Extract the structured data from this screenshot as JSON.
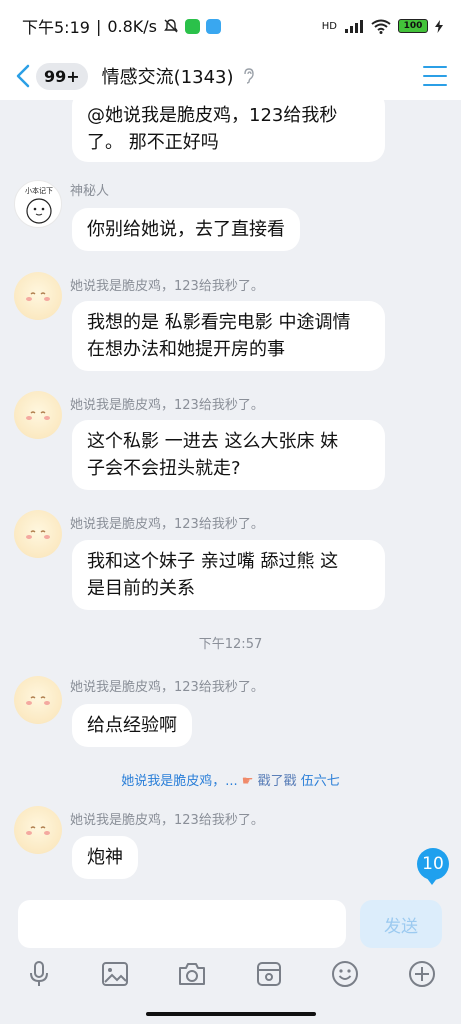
{
  "status": {
    "time": "下午5:19",
    "speed": "0.8K/s",
    "network": "HD",
    "battery": "100"
  },
  "header": {
    "unread_badge": "99+",
    "title": "情感交流(1343)",
    "accent": "#2b9fe6"
  },
  "messages": [
    {
      "sender": "",
      "text": "@她说我是脆皮鸡，123给我秒\n了。 那不正好吗"
    },
    {
      "sender": "神秘人",
      "avatar_text": "小本记下",
      "text": "你别给她说，去了直接看"
    },
    {
      "sender": "她说我是脆皮鸡，123给我秒了。",
      "text": "我想的是 私影看完电影 中途调情\n在想办法和她提开房的事"
    },
    {
      "sender": "她说我是脆皮鸡，123给我秒了。",
      "text": "这个私影 一进去 这么大张床 妹\n子会不会扭头就走?"
    },
    {
      "sender": "她说我是脆皮鸡，123给我秒了。",
      "text": "我和这个妹子 亲过嘴 舔过熊 这\n是目前的关系"
    },
    {
      "sender": "她说我是脆皮鸡，123给我秒了。",
      "text": "给点经验啊"
    },
    {
      "sender": "她说我是脆皮鸡，123给我秒了。",
      "text": "炮神"
    }
  ],
  "timestamp": "下午12:57",
  "notice": {
    "from": "她说我是脆皮鸡，...",
    "action": "戳了戳",
    "to": "伍六七"
  },
  "unread_count": "10",
  "input": {
    "placeholder": "",
    "send_label": "发送"
  },
  "toolbar_icons": [
    "microphone-icon",
    "image-icon",
    "camera-icon",
    "sticker-pack-icon",
    "emoji-icon",
    "plus-icon"
  ]
}
